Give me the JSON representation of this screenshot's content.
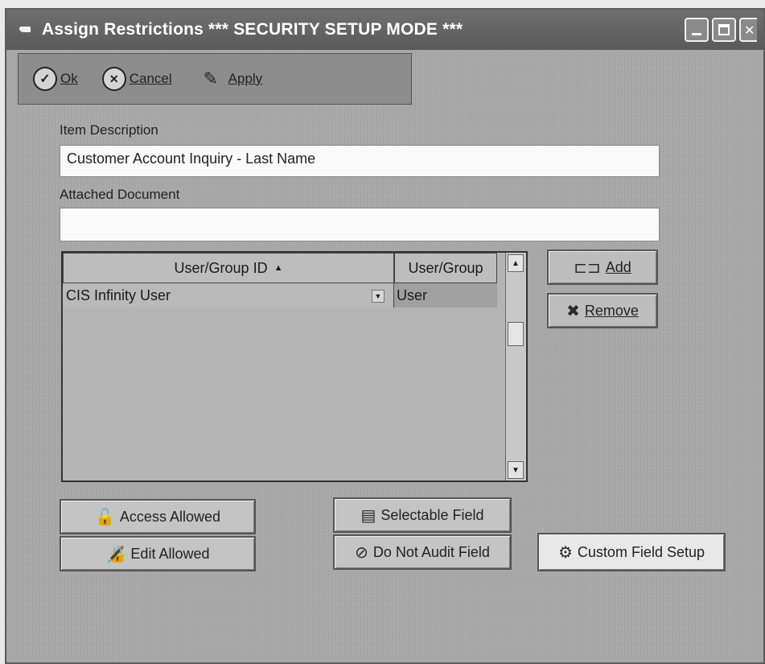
{
  "window": {
    "title": "Assign Restrictions *** SECURITY SETUP MODE ***"
  },
  "toolbar": {
    "ok_label": "Ok",
    "cancel_label": "Cancel",
    "apply_label": "Apply"
  },
  "form": {
    "item_description_label": "Item Description",
    "item_description_value": "Customer Account Inquiry - Last Name",
    "attached_document_label": "Attached Document",
    "attached_document_value": ""
  },
  "grid": {
    "columns": [
      "User/Group ID",
      "User/Group"
    ],
    "rows": [
      {
        "id": "CIS Infinity User",
        "type": "User"
      }
    ]
  },
  "side_buttons": {
    "add_label": "Add",
    "remove_label": "Remove"
  },
  "bottom_buttons": {
    "access_allowed": "Access Allowed",
    "edit_allowed": "Edit Allowed",
    "selectable_field": "Selectable Field",
    "do_not_audit_field": "Do Not Audit Field",
    "custom_field_setup": "Custom Field Setup"
  }
}
